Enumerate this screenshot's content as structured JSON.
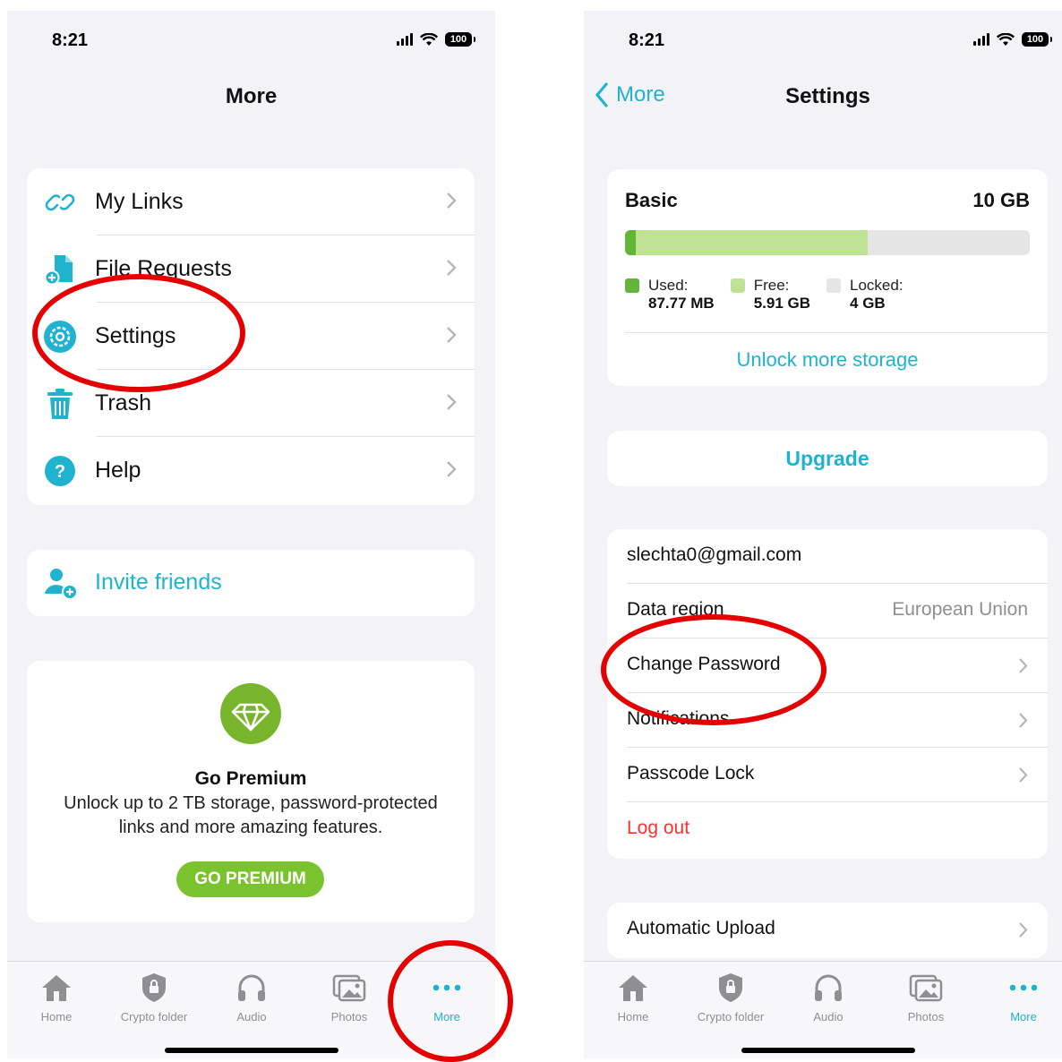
{
  "colors": {
    "accent": "#1fb3cf",
    "premium_green": "#7ac22e",
    "used": "#62b43a",
    "free": "#bfe395",
    "locked": "#e5e5e5",
    "logout": "#ff2d2d",
    "annotation": "#e50000"
  },
  "left": {
    "status": {
      "time": "8:21",
      "battery": "100"
    },
    "title": "More",
    "menu": [
      {
        "label": "My Links",
        "icon": "link-icon"
      },
      {
        "label": "File Requests",
        "icon": "file-request-icon"
      },
      {
        "label": "Settings",
        "icon": "settings-icon"
      },
      {
        "label": "Trash",
        "icon": "trash-icon"
      },
      {
        "label": "Help",
        "icon": "help-icon"
      }
    ],
    "invite": {
      "label": "Invite friends",
      "icon": "add-user-icon"
    },
    "premium": {
      "icon": "diamond-icon",
      "title": "Go Premium",
      "text": "Unlock up to 2 TB storage, password-protected links and more amazing features.",
      "button": "GO PREMIUM"
    }
  },
  "right": {
    "status": {
      "time": "8:21",
      "battery": "100"
    },
    "back_label": "More",
    "title": "Settings",
    "storage": {
      "plan": "Basic",
      "total": "10 GB",
      "used_fraction": 0.009,
      "free_fraction": 0.591,
      "used": {
        "label": "Used:",
        "value": "87.77 MB"
      },
      "free": {
        "label": "Free:",
        "value": "5.91 GB"
      },
      "locked": {
        "label": "Locked:",
        "value": "4 GB"
      },
      "unlock_label": "Unlock more storage"
    },
    "upgrade_label": "Upgrade",
    "account": {
      "email": "slechta0@gmail.com",
      "data_region_label": "Data region",
      "data_region_value": "European Union",
      "change_password": "Change Password",
      "notifications": "Notifications",
      "passcode_lock": "Passcode Lock",
      "logout": "Log out"
    },
    "automatic_upload": "Automatic Upload"
  },
  "tabs": [
    {
      "label": "Home",
      "icon": "home-icon"
    },
    {
      "label": "Crypto folder",
      "icon": "shield-lock-icon"
    },
    {
      "label": "Audio",
      "icon": "headphones-icon"
    },
    {
      "label": "Photos",
      "icon": "photos-icon"
    },
    {
      "label": "More",
      "icon": "more-dots-icon",
      "active": true
    }
  ]
}
